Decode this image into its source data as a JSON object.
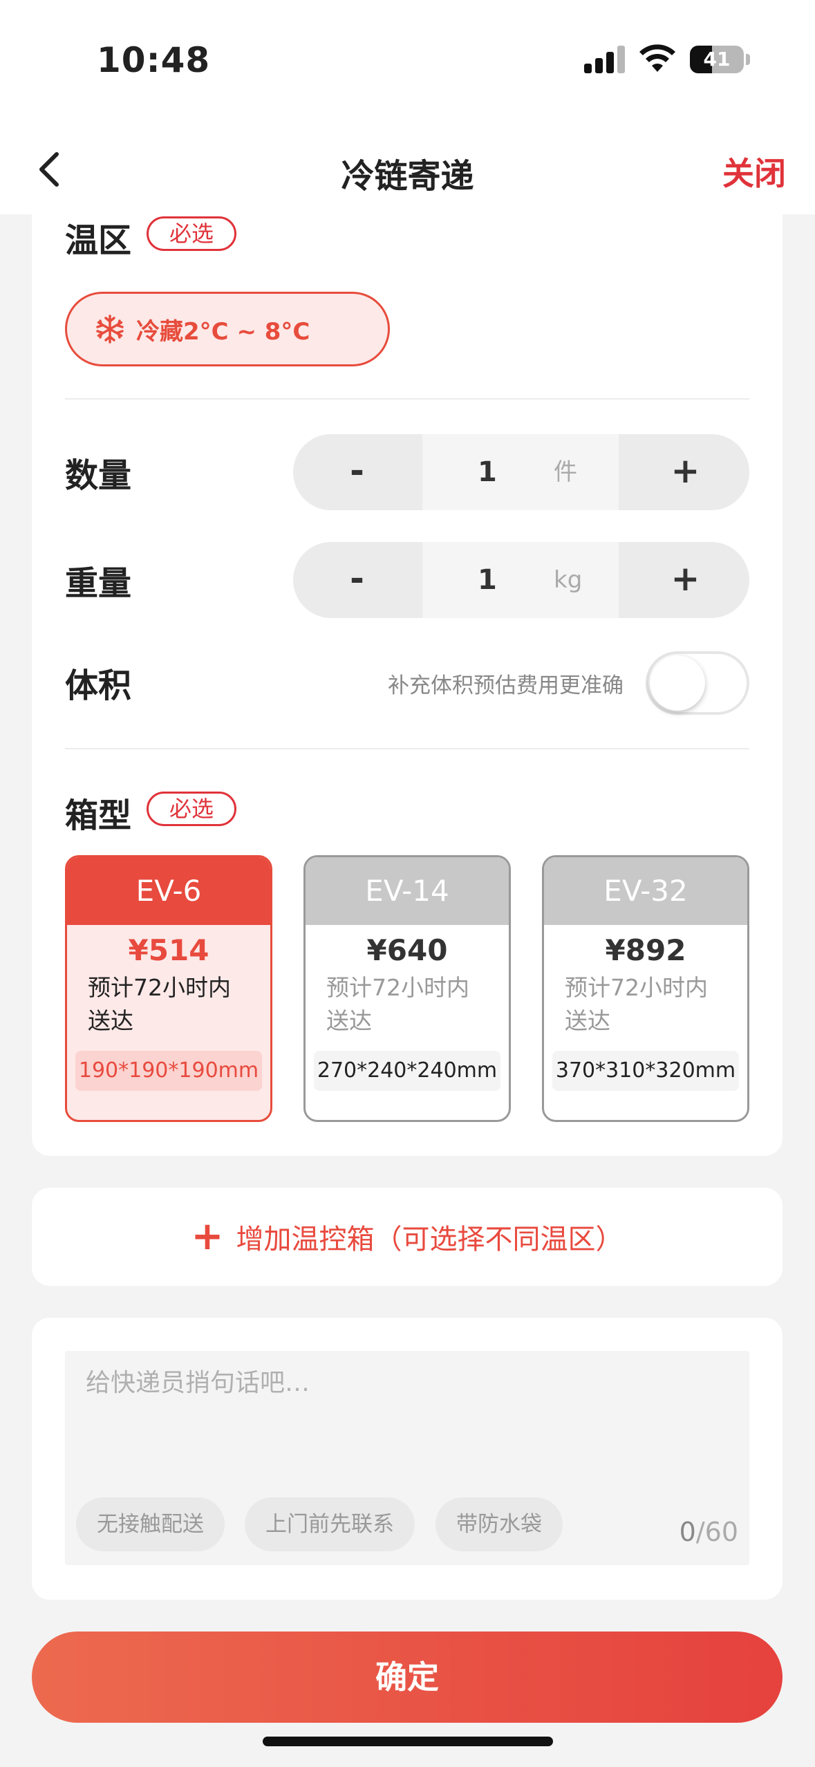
{
  "status_bar": {
    "time": "10:48",
    "battery": "41",
    "battery_level": 0.41,
    "signal_bars": 4
  },
  "nav": {
    "title": "冷链寄递",
    "close_label": "关闭",
    "back_icon": "chevron-left-icon"
  },
  "temp_zone": {
    "label": "温区",
    "required_label": "必选",
    "option": {
      "icon": "snowflake-icon",
      "label": "冷藏2°C ~ 8°C",
      "selected": true
    }
  },
  "quantity": {
    "label": "数量",
    "minus": "-",
    "value": "1",
    "unit": "件",
    "plus": "+"
  },
  "weight": {
    "label": "重量",
    "minus": "-",
    "value": "1",
    "unit": "kg",
    "plus": "+"
  },
  "volume": {
    "label": "体积",
    "hint": "补充体积预估费用更准确",
    "toggle_on": false
  },
  "box_type": {
    "label": "箱型",
    "required_label": "必选",
    "options": [
      {
        "name": "EV-6",
        "price": "¥514",
        "desc": "预计72小时内送达",
        "size": "190*190*190mm",
        "selected": true
      },
      {
        "name": "EV-14",
        "price": "¥640",
        "desc": "预计72小时内送达",
        "size": "270*240*240mm",
        "selected": false
      },
      {
        "name": "EV-32",
        "price": "¥892",
        "desc": "预计72小时内送达",
        "size": "370*310*320mm",
        "selected": false
      }
    ]
  },
  "add_box": {
    "icon": "plus-icon",
    "label": "增加温控箱（可选择不同温区）"
  },
  "note": {
    "placeholder": "给快递员捎句话吧…",
    "tags": [
      "无接触配送",
      "上门前先联系",
      "带防水袋"
    ],
    "count": "0",
    "max": "/60"
  },
  "confirm_label": "确定",
  "colors": {
    "accent": "#e84a3e",
    "accent_light": "#fde9e8",
    "inactive_head": "#c8c8c8"
  }
}
